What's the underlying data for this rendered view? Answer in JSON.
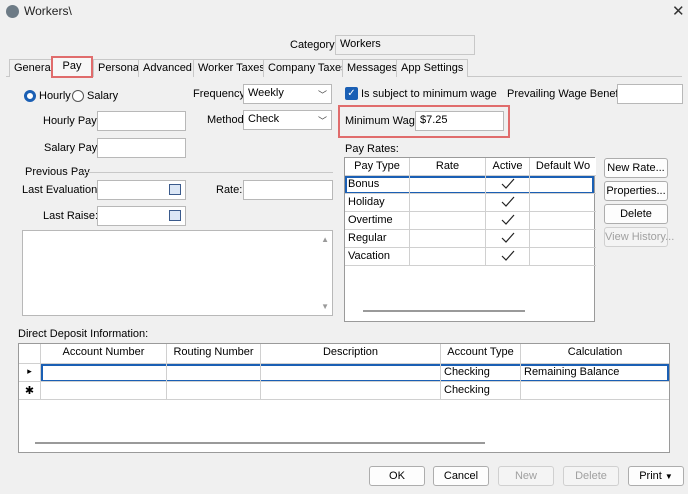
{
  "window": {
    "title": "Workers\\"
  },
  "category": {
    "label": "Category:",
    "value": "Workers"
  },
  "tabs": [
    "General",
    "Pay",
    "Personal",
    "Advanced",
    "Worker Taxes",
    "Company Taxes",
    "Messages",
    "App Settings"
  ],
  "pay_type": {
    "hourly": "Hourly",
    "salary": "Salary",
    "selected": "Hourly"
  },
  "fields": {
    "hourly_pay": "Hourly Pay:",
    "salary_pay": "Salary Pay:",
    "frequency_label": "Frequency:",
    "frequency_value": "Weekly",
    "method_label": "Method:",
    "method_value": "Check",
    "min_wage_checkbox": "Is subject to minimum wage",
    "prevailing_wage": "Prevailing Wage Benefit:",
    "minimum_wage_label": "Minimum Wage:",
    "minimum_wage_value": "$7.25"
  },
  "previous_pay": {
    "title": "Previous Pay",
    "last_evaluation": "Last Evaluation:",
    "rate": "Rate:",
    "last_raise": "Last Raise:"
  },
  "pay_rates": {
    "title": "Pay Rates:",
    "columns": [
      "Pay Type",
      "Rate",
      "Active",
      "Default Wo"
    ],
    "rows": [
      {
        "type": "Bonus",
        "active": true
      },
      {
        "type": "Holiday",
        "active": true
      },
      {
        "type": "Overtime",
        "active": true
      },
      {
        "type": "Regular",
        "active": true
      },
      {
        "type": "Vacation",
        "active": true
      }
    ],
    "buttons": [
      "New Rate...",
      "Properties...",
      "Delete",
      "View History..."
    ]
  },
  "direct_deposit": {
    "title": "Direct Deposit Information:",
    "columns": [
      "Account Number",
      "Routing Number",
      "Description",
      "Account Type",
      "Calculation"
    ],
    "rows": [
      {
        "indicator": "▸",
        "account_type": "Checking",
        "calculation": "Remaining Balance"
      },
      {
        "indicator": "✱",
        "account_type": "Checking",
        "calculation": ""
      }
    ]
  },
  "footer_buttons": {
    "ok": "OK",
    "cancel": "Cancel",
    "new": "New",
    "delete": "Delete",
    "print": "Print"
  },
  "colors": {
    "highlight": "#e06c6c",
    "accent": "#1a5fb4"
  }
}
